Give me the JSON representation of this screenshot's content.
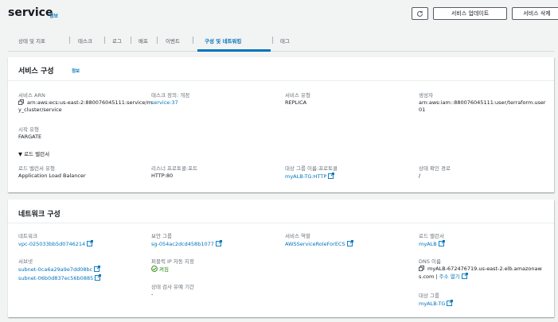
{
  "header": {
    "title": "service",
    "info": "정보",
    "refresh_icon": "refresh-icon",
    "update_button": "서비스 업데이트",
    "delete_button": "서비스 삭제"
  },
  "tabs": [
    {
      "label": "상태 및 지표"
    },
    {
      "label": "태스크"
    },
    {
      "label": "로그"
    },
    {
      "label": "배포"
    },
    {
      "label": "이벤트"
    },
    {
      "label": "구성 및 네트워킹"
    },
    {
      "label": "태그"
    }
  ],
  "service_config": {
    "title": "서비스 구성",
    "info": "정보",
    "arn_label": "서비스 ARN",
    "arn_value": "arn:aws:ecs:us-east-2:880076045111:service/my_cluster/service",
    "task_def_label": "태스크 정의: 개정",
    "task_def_value": "service:37",
    "service_type_label": "서비스 유형",
    "service_type_value": "REPLICA",
    "creator_label": "생성자",
    "creator_value": "arn:aws:iam::880076045111:user/terraform.user01",
    "launch_type_label": "시작 유형",
    "launch_type_value": "FARGATE",
    "lb_section_label": "로드 밸런서",
    "lb_type_label": "로드 밸런서 유형",
    "lb_type_value": "Application Load Balancer",
    "listener_label": "리스너 프로토콜:포트",
    "listener_value": "HTTP:80",
    "target_group_label": "대상 그룹 이름:프로토콜",
    "target_group_value": "myALB-TG:HTTP",
    "health_path_label": "상태 확인 경로",
    "health_path_value": "/"
  },
  "network_config": {
    "title": "네트워크 구성",
    "network_label": "네트워크",
    "network_value": "vpc-025033bb5d0746214",
    "subnet_label": "서브넷",
    "subnet_values": [
      "subnet-0ca6a29a9e7dd08bc",
      "subnet-06b0d837ec56b0885"
    ],
    "security_group_label": "보안 그룹",
    "security_group_value": "sg-054ac2dcd458b1077",
    "public_ip_label": "퍼블릭 IP 자동 지정",
    "public_ip_value": "켜짐",
    "health_grace_label": "상태 검사 유예 기간",
    "health_grace_value": "-",
    "service_role_label": "서비스 역할",
    "service_role_value": "AWSServiceRoleForECS",
    "lb_label": "로드 밸런서",
    "lb_value": "myALB",
    "dns_label": "DNS 이름",
    "dns_value": "myALB-672476719.us-east-2.elb.amazonaws.com",
    "dns_open_link": "주소 열기",
    "target_group_label": "대상 그룹",
    "target_group_value": "myALB-TG"
  },
  "colors": {
    "link": "#0073bb",
    "success": "#1d8102",
    "background": "#f2f3f3"
  }
}
